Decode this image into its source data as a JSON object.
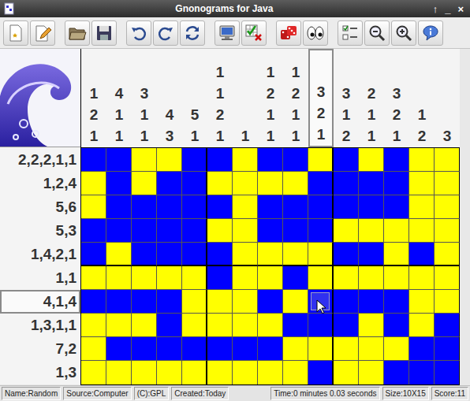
{
  "window": {
    "title": "Gnonograms for Java",
    "controls": [
      "↑",
      "_",
      "×"
    ]
  },
  "puzzle": {
    "row_clues": [
      {
        "text": "2,2,2,1,1",
        "selected": false
      },
      {
        "text": "1,2,4",
        "selected": false
      },
      {
        "text": "5,6",
        "selected": false
      },
      {
        "text": "5,3",
        "selected": false
      },
      {
        "text": "1,4,2,1",
        "selected": false
      },
      {
        "text": "1,1",
        "selected": false
      },
      {
        "text": "4,1,4",
        "selected": true
      },
      {
        "text": "1,3,1,1",
        "selected": false
      },
      {
        "text": "7,2",
        "selected": false
      },
      {
        "text": "1,3",
        "selected": false
      }
    ],
    "column_clues": [
      {
        "numbers": [
          "1",
          "2",
          "1"
        ],
        "selected": false
      },
      {
        "numbers": [
          "4",
          "1",
          "1"
        ],
        "selected": false
      },
      {
        "numbers": [
          "3",
          "1",
          "1"
        ],
        "selected": false
      },
      {
        "numbers": [
          "4",
          "3"
        ],
        "selected": false
      },
      {
        "numbers": [
          "5",
          "1"
        ],
        "selected": false
      },
      {
        "numbers": [
          "1",
          "1",
          "2",
          "1"
        ],
        "selected": false
      },
      {
        "numbers": [
          "1"
        ],
        "selected": false
      },
      {
        "numbers": [
          "1",
          "2",
          "1",
          "1"
        ],
        "selected": false
      },
      {
        "numbers": [
          "1",
          "2",
          "1",
          "1"
        ],
        "selected": false
      },
      {
        "numbers": [
          "3",
          "2",
          "1"
        ],
        "selected": true
      },
      {
        "numbers": [
          "3",
          "1",
          "2"
        ],
        "selected": false
      },
      {
        "numbers": [
          "2",
          "1",
          "1"
        ],
        "selected": false
      },
      {
        "numbers": [
          "3",
          "2",
          "1"
        ],
        "selected": false
      },
      {
        "numbers": [
          "1",
          "2"
        ],
        "selected": false
      },
      {
        "numbers": [
          "3"
        ],
        "selected": false
      }
    ],
    "grid": [
      [
        true,
        true,
        false,
        false,
        true,
        true,
        false,
        true,
        true,
        false,
        true,
        false,
        true,
        false,
        false
      ],
      [
        false,
        true,
        false,
        true,
        true,
        false,
        false,
        false,
        false,
        true,
        true,
        true,
        true,
        false,
        false
      ],
      [
        false,
        true,
        true,
        true,
        true,
        true,
        false,
        true,
        true,
        true,
        true,
        true,
        true,
        false,
        false
      ],
      [
        true,
        true,
        true,
        true,
        true,
        false,
        false,
        true,
        true,
        true,
        false,
        false,
        false,
        false,
        false
      ],
      [
        true,
        false,
        true,
        true,
        true,
        true,
        false,
        false,
        false,
        false,
        true,
        true,
        false,
        true,
        false
      ],
      [
        false,
        false,
        false,
        false,
        false,
        true,
        false,
        false,
        true,
        false,
        false,
        false,
        false,
        false,
        false
      ],
      [
        true,
        true,
        true,
        true,
        false,
        false,
        false,
        true,
        false,
        true,
        true,
        true,
        true,
        false,
        false
      ],
      [
        false,
        false,
        false,
        true,
        false,
        false,
        false,
        false,
        true,
        true,
        true,
        false,
        true,
        false,
        true
      ],
      [
        false,
        true,
        true,
        true,
        true,
        true,
        true,
        true,
        false,
        false,
        false,
        false,
        false,
        true,
        true
      ],
      [
        false,
        false,
        false,
        false,
        false,
        false,
        false,
        false,
        false,
        true,
        false,
        false,
        true,
        true,
        true
      ]
    ],
    "cursor": {
      "row": 6,
      "col": 9
    }
  },
  "status_bar": {
    "left": [
      "Name:Random",
      "Source:Computer",
      "(C):GPL",
      "Created:Today"
    ],
    "right": [
      "Time:0 minutes 0.03 seconds",
      "Size:10X15",
      "Score:11"
    ]
  }
}
